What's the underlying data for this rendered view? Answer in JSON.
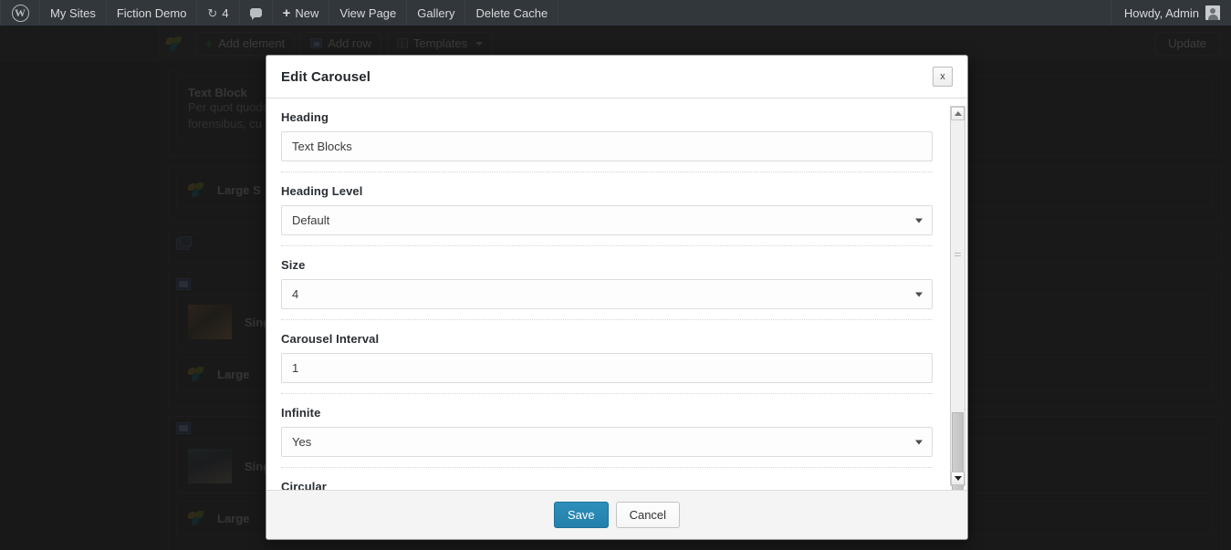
{
  "adminbar": {
    "logo_icon": "wordpress-logo-icon",
    "items": [
      {
        "label": "My Sites",
        "icon": null
      },
      {
        "label": "Fiction Demo",
        "icon": null
      },
      {
        "label": "4",
        "icon": "refresh-icon"
      },
      {
        "label": "",
        "icon": "comment-icon"
      },
      {
        "label": "New",
        "icon": "plus-icon"
      },
      {
        "label": "View Page",
        "icon": null
      },
      {
        "label": "Gallery",
        "icon": null
      },
      {
        "label": "Delete Cache",
        "icon": null
      }
    ],
    "howdy": "Howdy, Admin",
    "avatar_icon": "avatar-icon"
  },
  "editbar": {
    "logo_icon": "visual-composer-leaf-icon",
    "buttons": [
      {
        "label": "Add element",
        "icon": "plus-icon"
      },
      {
        "label": "Add row",
        "icon": "row-icon"
      },
      {
        "label": "Templates",
        "icon": "templates-icon",
        "caret": true
      }
    ],
    "update_label": "Update"
  },
  "canvas": {
    "blocks": [
      {
        "icons": [],
        "elements": [
          {
            "title": "Text Block",
            "body": "Per quot quodsi\nforensibus, cu",
            "thumb": null
          }
        ]
      },
      {
        "icons": [],
        "elements": [
          {
            "title": "Large S",
            "body": "",
            "thumb": "leaf"
          }
        ]
      },
      {
        "icons": [
          "row-icon"
        ],
        "elements": []
      },
      {
        "icons": [
          "image-icon"
        ],
        "elements": [
          {
            "title": "Single",
            "body": "",
            "thumb": "photo-1"
          },
          {
            "title": "Large",
            "body": "",
            "thumb": "leaf"
          }
        ]
      },
      {
        "icons": [
          "image-icon"
        ],
        "elements": [
          {
            "title": "Single",
            "body": "",
            "thumb": "photo-2"
          },
          {
            "title": "Large",
            "body": "",
            "thumb": "leaf"
          }
        ]
      }
    ]
  },
  "modal": {
    "title": "Edit Carousel",
    "close_label": "x",
    "close_icon": "close-icon",
    "fields": [
      {
        "label": "Heading",
        "type": "text",
        "value": "Text Blocks",
        "name": "heading"
      },
      {
        "label": "Heading Level",
        "type": "select",
        "value": "Default",
        "name": "heading-level"
      },
      {
        "label": "Size",
        "type": "select",
        "value": "4",
        "name": "size"
      },
      {
        "label": "Carousel Interval",
        "type": "text",
        "value": "1",
        "name": "carousel-interval"
      },
      {
        "label": "Infinite",
        "type": "select",
        "value": "Yes",
        "name": "infinite"
      },
      {
        "label": "Circular",
        "type": "select",
        "value": "",
        "name": "circular"
      }
    ],
    "footer": {
      "save_label": "Save",
      "cancel_label": "Cancel"
    },
    "accent_color": "#2380ad"
  }
}
